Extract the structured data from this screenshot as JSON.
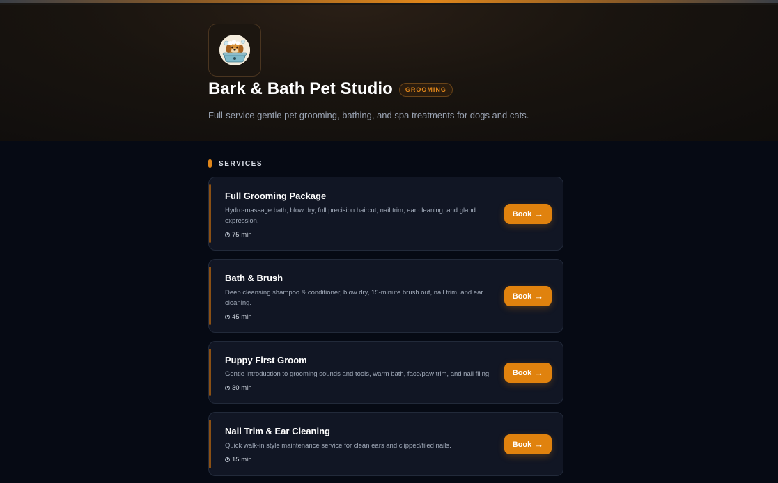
{
  "business": {
    "name": "Bark & Bath Pet Studio",
    "category_badge": "GROOMING",
    "tagline": "Full-service gentle pet grooming, bathing, and spa treatments for dogs and cats."
  },
  "services_section": {
    "title": "SERVICES",
    "book_label": "Book",
    "items": [
      {
        "name": "Full Grooming Package",
        "description": "Hydro-massage bath, blow dry, full precision haircut, nail trim, ear cleaning, and gland expression.",
        "duration": "75 min"
      },
      {
        "name": "Bath & Brush",
        "description": "Deep cleansing shampoo & conditioner, blow dry, 15-minute brush out, nail trim, and ear cleaning.",
        "duration": "45 min"
      },
      {
        "name": "Puppy First Groom",
        "description": "Gentle introduction to grooming sounds and tools, warm bath, face/paw trim, and nail filing.",
        "duration": "30 min"
      },
      {
        "name": "Nail Trim & Ear Cleaning",
        "description": "Quick walk-in style maintenance service for clean ears and clipped/filed nails.",
        "duration": "15 min"
      }
    ]
  },
  "icons": {
    "logo": "dog-in-bathtub-logo",
    "duration": "clock-icon",
    "book": "arrow-right-icon"
  },
  "colors": {
    "accent": "#e0820e",
    "background": "#060a14",
    "card": "#111624"
  }
}
